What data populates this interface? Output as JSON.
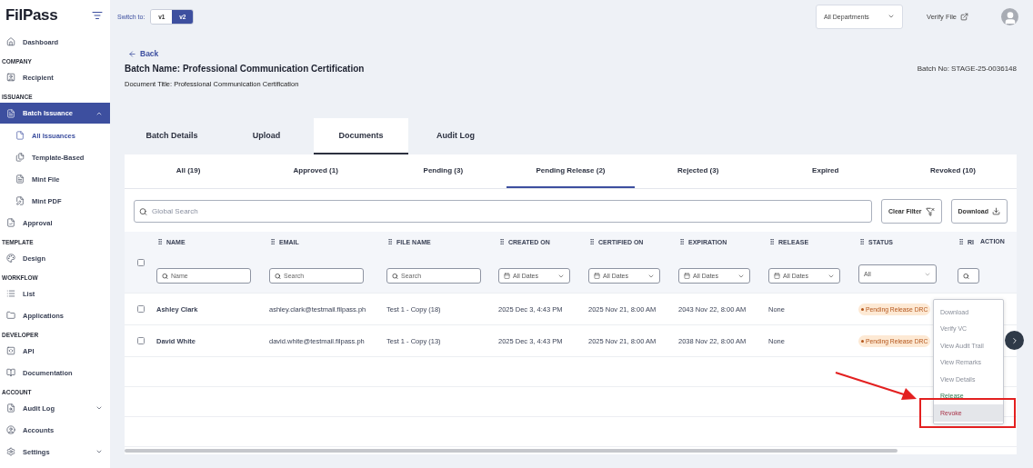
{
  "sidebar": {
    "logo": "FilPass",
    "sections": [
      {
        "items": [
          {
            "label": "Dashboard",
            "selected": false
          }
        ]
      },
      {
        "heading": "COMPANY",
        "items": [
          {
            "label": "Recipient",
            "selected": false
          }
        ]
      },
      {
        "heading": "ISSUANCE",
        "items": [
          {
            "label": "Batch Issuance",
            "selected": true,
            "expanded": true,
            "children": [
              {
                "label": "All Issuances",
                "selected": true
              },
              {
                "label": "Template-Based",
                "selected": false
              },
              {
                "label": "Mint File",
                "selected": false
              },
              {
                "label": "Mint PDF",
                "selected": false
              }
            ]
          },
          {
            "label": "Approval",
            "selected": false
          }
        ]
      },
      {
        "heading": "TEMPLATE",
        "items": [
          {
            "label": "Design",
            "selected": false
          }
        ]
      },
      {
        "heading": "WORKFLOW",
        "items": [
          {
            "label": "List",
            "selected": false
          },
          {
            "label": "Applications",
            "selected": false
          }
        ]
      },
      {
        "heading": "DEVELOPER",
        "items": [
          {
            "label": "API",
            "selected": false
          },
          {
            "label": "Documentation",
            "selected": false
          }
        ]
      },
      {
        "heading": "ACCOUNT",
        "items": [
          {
            "label": "Audit Log",
            "selected": false,
            "expanded": false
          },
          {
            "label": "Accounts",
            "selected": false
          },
          {
            "label": "Settings",
            "selected": false,
            "expanded": false
          }
        ]
      }
    ]
  },
  "topbar": {
    "switch_label": "Switch to:",
    "versions": [
      {
        "label": "v1",
        "selected": false
      },
      {
        "label": "v2",
        "selected": true
      }
    ],
    "department": "All Departments",
    "verify": "Verify File"
  },
  "header": {
    "back": "Back",
    "batch_name": "Batch Name: Professional Communication Certification",
    "batch_no": "Batch No: STAGE-25-0036148",
    "document_title": "Document Title: Professional Communication Certification"
  },
  "tabs": [
    {
      "label": "Batch Details",
      "selected": false
    },
    {
      "label": "Upload",
      "selected": false
    },
    {
      "label": "Documents",
      "selected": true
    },
    {
      "label": "Audit Log",
      "selected": false
    }
  ],
  "subtabs": [
    {
      "label": "All (19)",
      "selected": false
    },
    {
      "label": "Approved (1)",
      "selected": false
    },
    {
      "label": "Pending (3)",
      "selected": false
    },
    {
      "label": "Pending Release (2)",
      "selected": true
    },
    {
      "label": "Rejected (3)",
      "selected": false
    },
    {
      "label": "Expired",
      "selected": false
    },
    {
      "label": "Revoked (10)",
      "selected": false
    }
  ],
  "toolbar": {
    "search_placeholder": "Global Search",
    "clear_filter": "Clear Filter",
    "download": "Download"
  },
  "table": {
    "select_all_checked": false,
    "columns": [
      {
        "label": "NAME",
        "filter": {
          "kind": "search",
          "placeholder": "Name"
        }
      },
      {
        "label": "EMAIL",
        "filter": {
          "kind": "search",
          "placeholder": "Search"
        }
      },
      {
        "label": "FILE NAME",
        "filter": {
          "kind": "search",
          "placeholder": "Search"
        }
      },
      {
        "label": "CREATED ON",
        "filter": {
          "kind": "date",
          "value": "All Dates"
        }
      },
      {
        "label": "CERTIFIED ON",
        "filter": {
          "kind": "date",
          "value": "All Dates"
        }
      },
      {
        "label": "EXPIRATION",
        "filter": {
          "kind": "date",
          "value": "All Dates"
        }
      },
      {
        "label": "RELEASE",
        "filter": {
          "kind": "date",
          "value": "All Dates"
        }
      },
      {
        "label": "STATUS",
        "filter": {
          "kind": "select",
          "value": "All"
        }
      },
      {
        "label": "RI",
        "filter": {
          "kind": "search"
        }
      }
    ],
    "action_label": "ACTION",
    "rows": [
      {
        "checked": false,
        "cells": [
          "Ashley Clark",
          "ashley.clark@testmail.filpass.ph",
          "Test 1 - Copy (18)",
          "2025 Dec 3, 4:43 PM",
          "2025 Nov 21, 8:00 AM",
          "2043 Nov 22, 8:00 AM",
          "None"
        ],
        "status": "Pending Release DRC"
      },
      {
        "checked": false,
        "cells": [
          "David White",
          "david.white@testmail.filpass.ph",
          "Test 1 - Copy (13)",
          "2025 Dec 3, 4:43 PM",
          "2025 Nov 21, 8:00 AM",
          "2038 Nov 22, 8:00 AM",
          "None"
        ],
        "status": "Pending Release DRC"
      }
    ]
  },
  "action_menu": [
    {
      "label": "Download",
      "kind": "normal",
      "selected": false
    },
    {
      "label": "Verify VC",
      "kind": "normal",
      "selected": false
    },
    {
      "label": "View Audit Trail",
      "kind": "normal",
      "selected": false
    },
    {
      "label": "View Remarks",
      "kind": "normal",
      "selected": false
    },
    {
      "label": "View Details",
      "kind": "normal",
      "selected": false
    },
    {
      "label": "Release",
      "kind": "success",
      "selected": false
    },
    {
      "label": "Revoke",
      "kind": "danger",
      "selected": true
    }
  ]
}
